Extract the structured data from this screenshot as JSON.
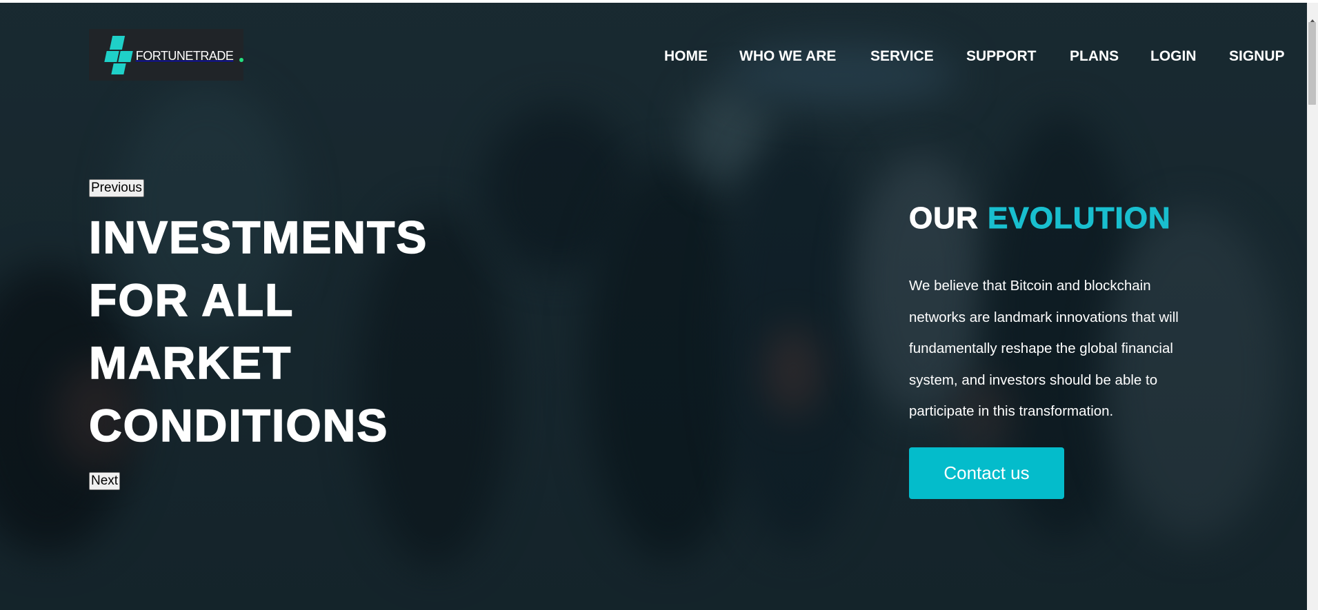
{
  "brand": {
    "name": "FORTUNETRADE",
    "mark_color": "#1fd0c8",
    "dot_color": "#24e07f"
  },
  "nav": [
    {
      "label": "HOME"
    },
    {
      "label": "WHO WE ARE"
    },
    {
      "label": "SERVICE"
    },
    {
      "label": "SUPPORT"
    },
    {
      "label": "PLANS"
    },
    {
      "label": "LOGIN"
    },
    {
      "label": "SIGNUP"
    }
  ],
  "slider": {
    "previous_label": "Previous",
    "next_label": "Next",
    "headline": [
      "INVESTMENTS",
      "FOR ALL",
      "MARKET",
      "CONDITIONS"
    ]
  },
  "evolution": {
    "title_prefix": "OUR",
    "title_accent": "EVOLUTION",
    "text": "We believe that Bitcoin and blockchain networks are landmark innovations that will fundamentally reshape the global financial system, and investors should be able to participate in this transformation.",
    "button_label": "Contact us"
  },
  "colors": {
    "accent": "#19bfcf",
    "button": "#04bccb",
    "hero_background": "#1b2c33"
  }
}
